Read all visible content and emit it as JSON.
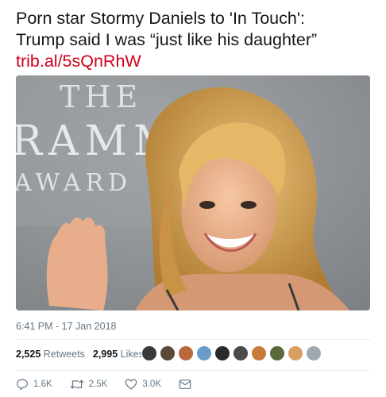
{
  "tweet": {
    "line1": "Porn star Stormy Daniels to 'In Touch':",
    "line2": "Trump said I was “just like his daughter”",
    "link": "trib.al/5sQnRhW"
  },
  "media": {
    "backdrop_text_1": "THE",
    "backdrop_text_2": "RAMM",
    "backdrop_text_3": "AWARD"
  },
  "timestamp": "6:41 PM - 17 Jan 2018",
  "stats": {
    "retweets_count": "2,525",
    "retweets_label": "Retweets",
    "likes_count": "2,995",
    "likes_label": "Likes"
  },
  "avatars": [
    {
      "color": "#3a3a3a"
    },
    {
      "color": "#5a4a3a"
    },
    {
      "color": "#b8683a"
    },
    {
      "color": "#6a9ac8"
    },
    {
      "color": "#2a2a2a"
    },
    {
      "color": "#4a4a4a"
    },
    {
      "color": "#c87a3a"
    },
    {
      "color": "#5a6a3a"
    },
    {
      "color": "#d8a060"
    },
    {
      "color": "#a0a8b0"
    }
  ],
  "actions": {
    "reply_count": "1.6K",
    "retweet_count": "2.5K",
    "like_count": "3.0K",
    "reply_icon": "reply-icon",
    "retweet_icon": "retweet-icon",
    "like_icon": "heart-icon",
    "dm_icon": "envelope-icon"
  }
}
